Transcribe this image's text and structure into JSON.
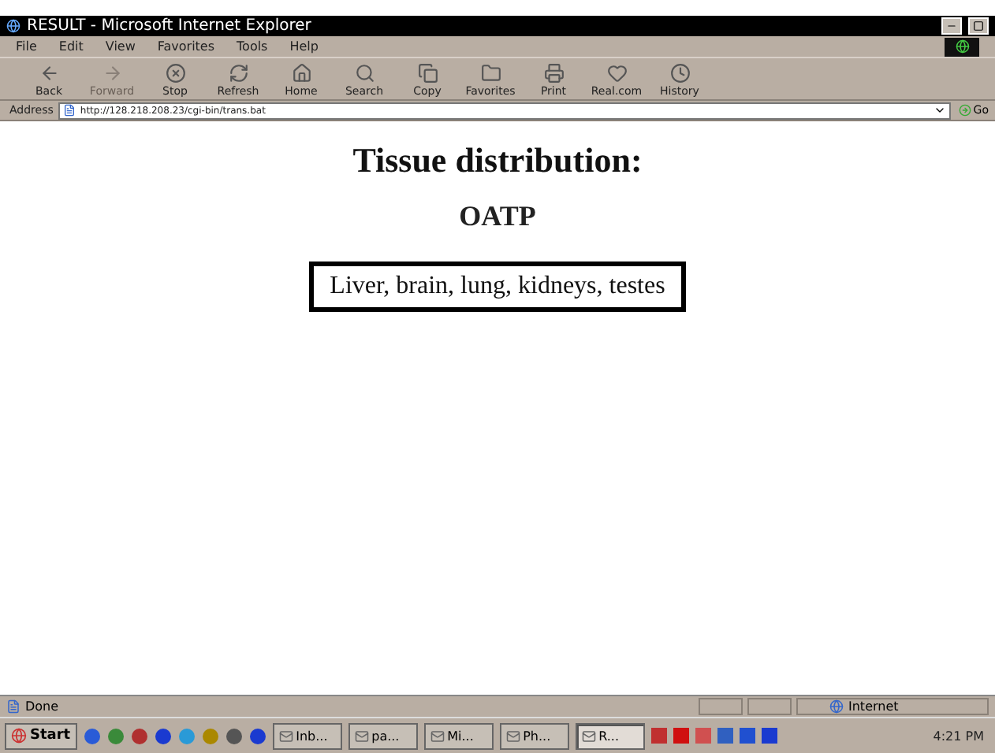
{
  "window": {
    "title": "RESULT - Microsoft Internet Explorer"
  },
  "menu": [
    "File",
    "Edit",
    "View",
    "Favorites",
    "Tools",
    "Help"
  ],
  "toolbar": [
    {
      "label": "Back",
      "disabled": false
    },
    {
      "label": "Forward",
      "disabled": true
    },
    {
      "label": "Stop",
      "disabled": false
    },
    {
      "label": "Refresh",
      "disabled": false
    },
    {
      "label": "Home",
      "disabled": false
    },
    {
      "label": "Search",
      "disabled": false
    },
    {
      "label": "Copy",
      "disabled": false
    },
    {
      "label": "Favorites",
      "disabled": false
    },
    {
      "label": "Print",
      "disabled": false
    },
    {
      "label": "Real.com",
      "disabled": false
    },
    {
      "label": "History",
      "disabled": false
    }
  ],
  "address": {
    "label": "Address",
    "value": "http://128.218.208.23/cgi-bin/trans.bat",
    "go": "Go"
  },
  "content": {
    "heading": "Tissue distribution:",
    "subheading": "OATP",
    "answer": "Liver, brain, lung, kidneys, testes"
  },
  "status_bar": {
    "text": "Done",
    "zone": "Internet"
  },
  "taskbar": {
    "start": "Start",
    "tasks": [
      {
        "label": "Inb...",
        "selected": false
      },
      {
        "label": "pa...",
        "selected": false
      },
      {
        "label": "Mi...",
        "selected": false
      },
      {
        "label": "Ph...",
        "selected": false
      },
      {
        "label": "R...",
        "selected": true
      }
    ],
    "clock": "4:21 PM"
  }
}
